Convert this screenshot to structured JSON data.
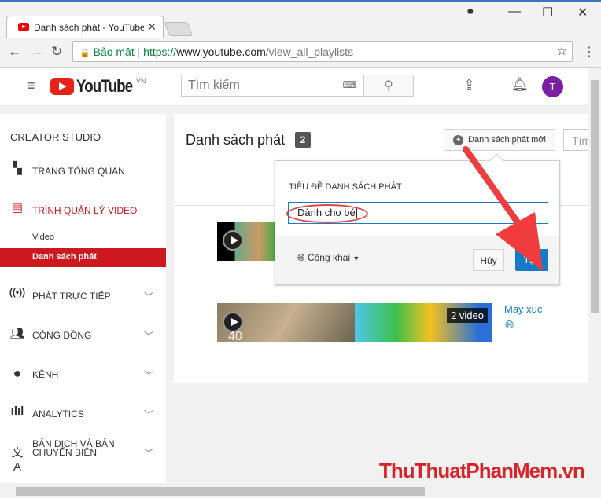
{
  "browser": {
    "tab_title": "Danh sách phát - YouTube",
    "secure_label": "Bảo mật",
    "url_scheme": "https://",
    "url_host": "www.youtube.com",
    "url_path": "/view_all_playlists"
  },
  "header": {
    "logo": "YouTube",
    "region": "VN",
    "search_placeholder": "Tìm kiếm",
    "avatar_letter": "T"
  },
  "sidebar": {
    "title": "CREATOR STUDIO",
    "items": [
      {
        "label": "TRANG TỔNG QUAN"
      },
      {
        "label": "TRÌNH QUẢN LÝ VIDEO"
      },
      {
        "label": "Video"
      },
      {
        "label": "Danh sách phát"
      },
      {
        "label": "PHÁT TRỰC TIẾP"
      },
      {
        "label": "CỘNG ĐỒNG"
      },
      {
        "label": "KÊNH"
      },
      {
        "label": "ANALYTICS"
      },
      {
        "label": "BẢN DỊCH VÀ BẢN CHUYỂN BIÊN"
      }
    ]
  },
  "main": {
    "title": "Danh sách phát",
    "count": "2",
    "new_playlist": "Danh sách phát mới",
    "search_partial": "Tìm",
    "playlists": [
      {
        "title": "May xuc",
        "video_count": "2 video",
        "overlay": "40"
      }
    ]
  },
  "popup": {
    "label": "TIÊU ĐỀ DANH SÁCH PHÁT",
    "value": "Dành cho bé",
    "privacy": "Công khai",
    "cancel": "Hủy",
    "create": "Tạo"
  },
  "watermark": "ThuThuatPhanMem.vn",
  "colors": {
    "accent_red": "#cc181e",
    "blue": "#167ac6",
    "annotation": "#f03c3c"
  }
}
